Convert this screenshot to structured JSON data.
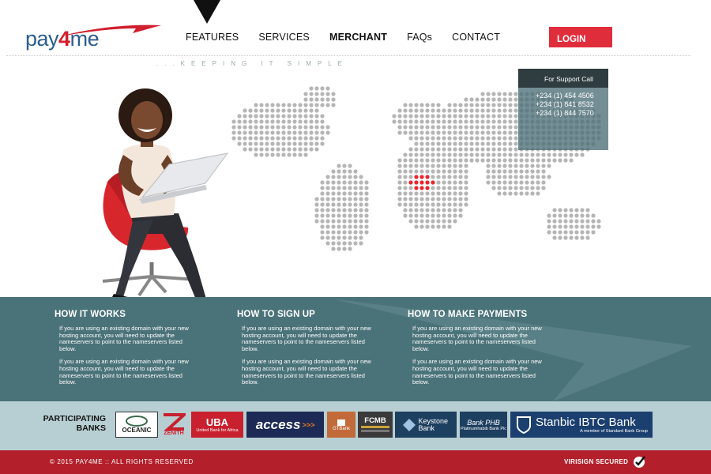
{
  "header": {
    "logo_prefix": "pay",
    "logo_four": "4",
    "logo_suffix": "me",
    "nav": [
      "FEATURES",
      "SERVICES",
      "MERCHANT",
      "FAQs",
      "CONTACT"
    ],
    "active_nav": "MERCHANT",
    "login_label": "LOGIN",
    "tagline": "...KEEPING IT SIMPLE"
  },
  "support": {
    "title": "For Support Call",
    "numbers": [
      "+234 (1) 454 4506",
      "+234 (1) 841 8532",
      "+234 (1) 844 7570"
    ]
  },
  "info": {
    "columns": [
      {
        "title": "HOW IT WORKS",
        "paragraphs": [
          "If you are using an existing domain with your new hosting account, you will need to update the nameservers to point to the nameservers listed below.",
          "If you are using an existing domain with your new hosting account, you will need to update the nameservers to point to the nameservers listed below."
        ]
      },
      {
        "title": "HOW TO SIGN UP",
        "paragraphs": [
          "If you are using an existing domain with your new hosting account, you will need to update the nameservers to point to the nameservers listed below.",
          "If you are using an existing domain with your new hosting account, you will need to update the nameservers to point to the nameservers listed below."
        ]
      },
      {
        "title": "HOW TO MAKE PAYMENTS",
        "paragraphs": [
          "If you are using an existing domain with your new hosting account, you will need to update the nameservers to point to the nameservers listed below.",
          "If you are using an existing domain with your new hosting account, you will need to update the nameservers to point to the nameservers listed below."
        ]
      }
    ]
  },
  "banks": {
    "label_line1": "PARTICIPATING",
    "label_line2": "BANKS",
    "oceanic": "OCEANIC",
    "zenith": "ZENITH",
    "uba": "UBA",
    "uba_sub": "United Bank for Africa",
    "access": "access",
    "access_arrows": ">>>",
    "gtbank": "GTBank",
    "fcmb": "FCMB",
    "keystone": "Keystone Bank",
    "bankphb": "Bank PHB",
    "bankphb_sub": "Platinumhabib Bank Plc",
    "stanbic": "Stanbic IBTC Bank",
    "stanbic_sub": "A member of Standard Bank Group"
  },
  "footer": {
    "copyright": "© 2015 PAY4ME :: ALL RIGHTS RESERVED",
    "verisign": "VIRISIGN SECURED"
  },
  "colors": {
    "brand_red": "#e02d3c",
    "brand_blue": "#2a5d8f",
    "teal_band": "#4a7279",
    "footer_red": "#b3202c",
    "banks_band": "#b7cfd3"
  },
  "icons": [
    "logo-swoosh-icon",
    "world-map-icon",
    "nigeria-highlight-icon",
    "check-icon"
  ]
}
